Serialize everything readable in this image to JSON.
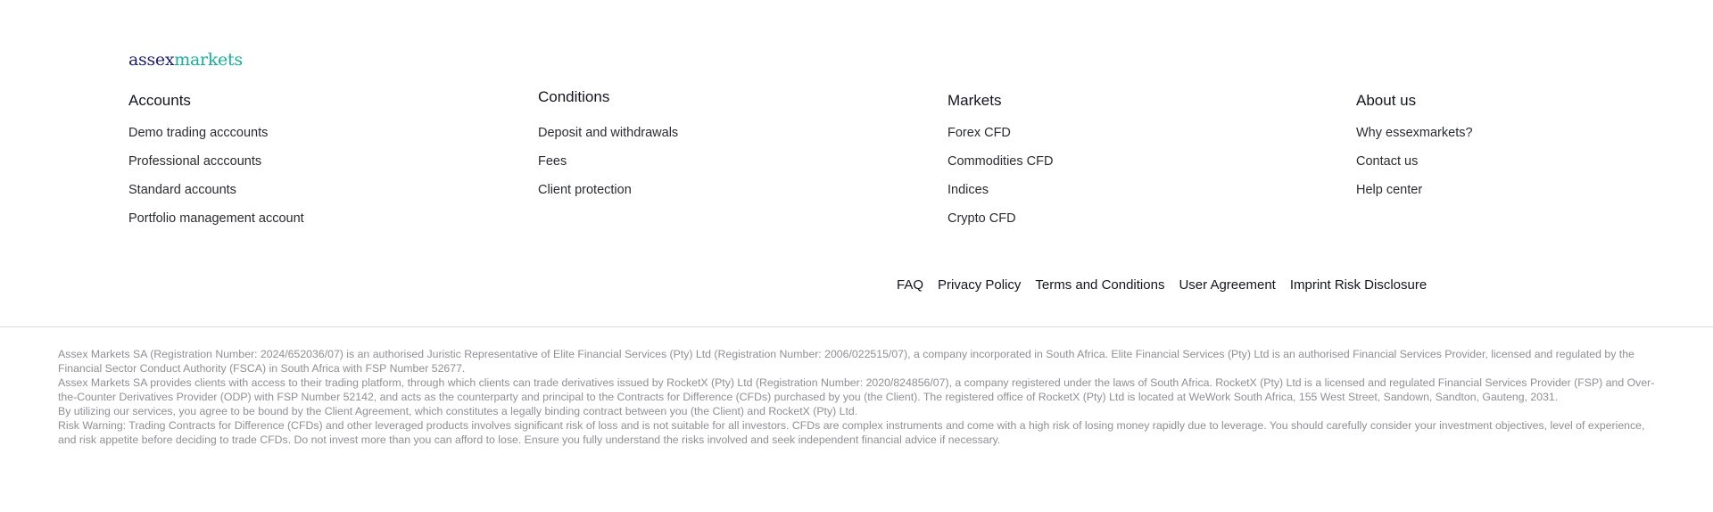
{
  "logo": {
    "part1": "assex",
    "part2": "markets"
  },
  "columns": [
    {
      "title": "Accounts",
      "links": [
        "Demo trading acccounts",
        "Professional acccounts",
        "Standard accounts",
        "Portfolio management account"
      ]
    },
    {
      "title": "Conditions",
      "links": [
        "Deposit and withdrawals",
        "Fees",
        "Client protection"
      ]
    },
    {
      "title": "Markets",
      "links": [
        "Forex CFD",
        "Commodities CFD",
        "Indices",
        "Crypto CFD"
      ]
    },
    {
      "title": "About us",
      "links": [
        "Why essexmarkets?",
        "Contact us",
        "Help center"
      ]
    }
  ],
  "bottom_links": [
    "FAQ",
    "Privacy Policy",
    "Terms and Conditions",
    "User Agreement",
    "Imprint Risk Disclosure"
  ],
  "legal": [
    "Assex Markets SA (Registration Number: 2024/652036/07) is an authorised Juristic Representative of Elite Financial Services (Pty) Ltd (Registration Number: 2006/022515/07), a company incorporated in South Africa. Elite Financial Services (Pty) Ltd is an authorised Financial Services Provider, licensed and regulated by the Financial Sector Conduct Authority (FSCA) in South Africa with FSP Number 52677.",
    "Assex Markets SA provides clients with access to their trading platform, through which clients can trade derivatives issued by RocketX (Pty) Ltd (Registration Number: 2020/824856/07), a company registered under the laws of South Africa. RocketX (Pty) Ltd is a licensed and regulated Financial Services Provider (FSP) and Over-the-Counter Derivatives Provider (ODP) with FSP Number 52142, and acts as the counterparty and principal to the Contracts for Difference (CFDs) purchased by you (the Client). The registered office of RocketX (Pty) Ltd is located at WeWork South Africa, 155 West Street, Sandown, Sandton, Gauteng, 2031.",
    "By utilizing our services, you agree to be bound by the Client Agreement, which constitutes a legally binding contract between you (the Client) and RocketX (Pty) Ltd.",
    "Risk Warning: Trading Contracts for Difference (CFDs) and other leveraged products involves significant risk of loss and is not suitable for all investors. CFDs are complex instruments and come with a high risk of losing money rapidly due to leverage. You should carefully consider your investment objectives, level of experience, and risk appetite before deciding to trade CFDs. Do not invest more than you can afford to lose. Ensure you fully understand the risks involved and seek independent financial advice if necessary."
  ]
}
